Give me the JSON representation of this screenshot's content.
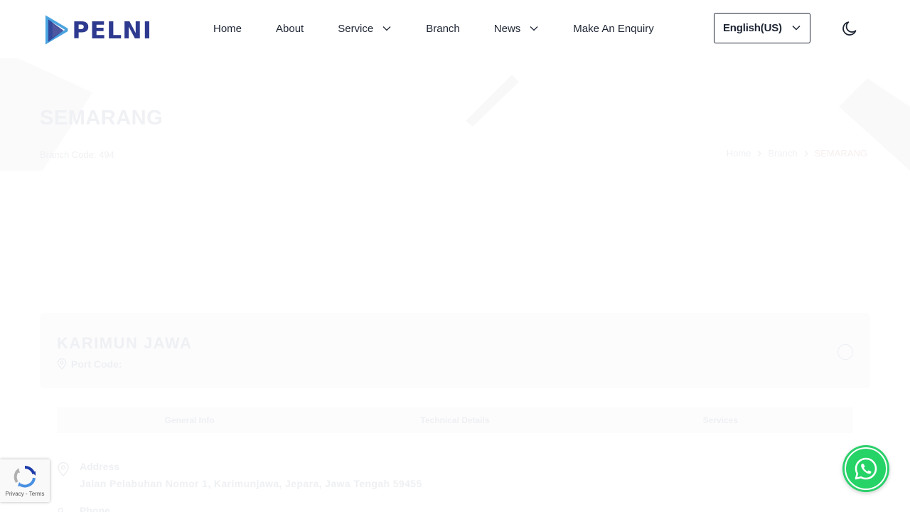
{
  "header": {
    "logo_text": "PELNI",
    "nav": {
      "home": "Home",
      "about": "About",
      "service": "Service",
      "branch": "Branch",
      "news": "News",
      "enquiry": "Make An Enquiry"
    },
    "language": "English(US)"
  },
  "page": {
    "title": "SEMARANG",
    "branch_code": "Branch Code: 494",
    "breadcrumb": [
      "Home",
      "Branch",
      "SEMARANG"
    ]
  },
  "port": {
    "name": "KARIMUN JAWA",
    "code_label": "Port Code:",
    "tabs": [
      "General Info",
      "Technical Details",
      "Services"
    ],
    "address_label": "Address",
    "address_value": "Jalan Pelabuhan Nomor 1, Karimunjawa, Jepara, Jawa Tengah 59455",
    "phone_label": "Phone"
  },
  "recaptcha": {
    "privacy": "Privacy",
    "separator": " - ",
    "terms": "Terms"
  },
  "colors": {
    "brand_blue": "#2e3a8f",
    "logo_light_blue": "#4aa3df",
    "whatsapp_green": "#25d366",
    "text_dark": "#1d2433"
  },
  "icons": {
    "service_dropdown": "chevron-down-icon",
    "news_dropdown": "chevron-down-icon",
    "language_dropdown": "chevron-down-icon",
    "theme_toggle": "moon-icon",
    "breadcrumb_separator": "chevron-right-icon",
    "port_code": "map-pin-icon",
    "address": "map-pin-icon",
    "phone": "phone-icon",
    "whatsapp": "whatsapp-icon",
    "recaptcha": "recaptcha-icon"
  }
}
